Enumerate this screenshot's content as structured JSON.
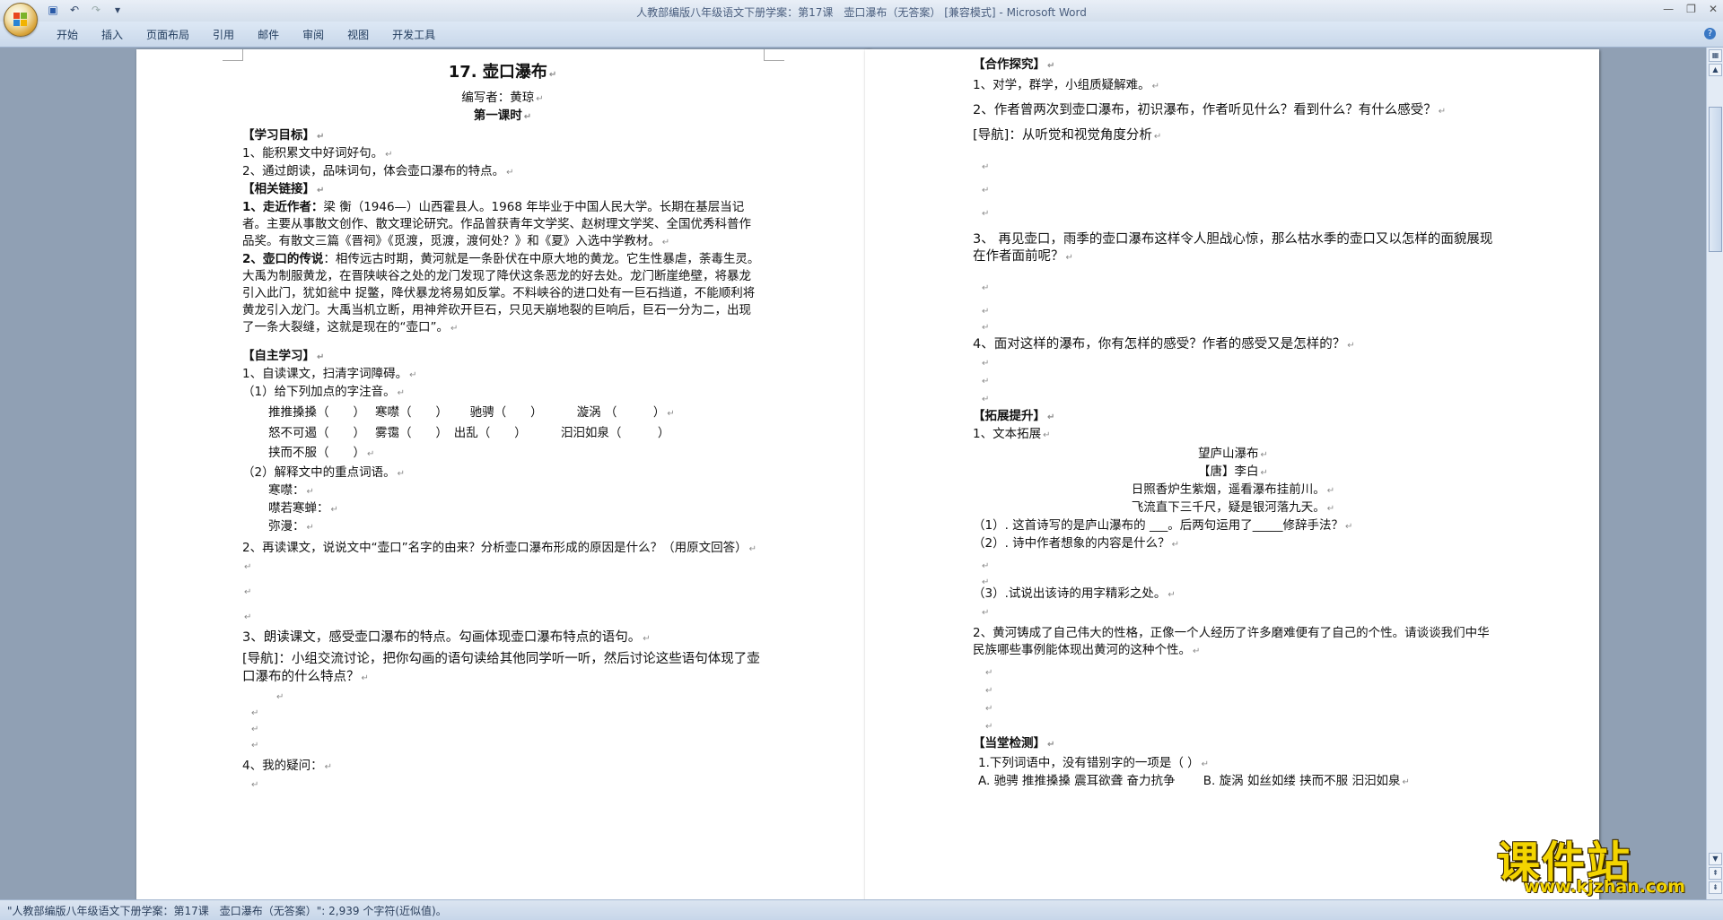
{
  "window": {
    "title": "人教部编版八年级语文下册学案：第17课　壶口瀑布（无答案） [兼容模式] - Microsoft Word"
  },
  "ribbon": {
    "tabs": [
      "开始",
      "插入",
      "页面布局",
      "引用",
      "邮件",
      "审阅",
      "视图",
      "开发工具"
    ]
  },
  "left_page": {
    "title": "17. 壶口瀑布",
    "author": "编写者：黄琼",
    "lesson": "第一课时",
    "goals_header": "【学习目标】",
    "goals": [
      "1、能积累文中好词好句。",
      "2、通过朗读，品味词句，体会壶口瀑布的特点。"
    ],
    "links_header": "【相关链接】",
    "link1_label": "1、走近作者：",
    "link1_text": "梁 衡（1946—）山西霍县人。1968 年毕业于中国人民大学。长期在基层当记者。主要从事散文创作、散文理论研究。作品曾获青年文学奖、赵树理文学奖、全国优秀科普作品奖。有散文三篇《晋祠》《觅渡，觅渡，渡何处？》和《夏》入选中学教材。",
    "link2_label": "2、壶口的传说",
    "link2_text": "：相传远古时期，黄河就是一条卧伏在中原大地的黄龙。它生性暴虐，荼毒生灵。大禹为制服黄龙，在晋陕峡谷之处的龙门发现了降伏这条恶龙的好去处。龙门断崖绝壁，将暴龙引入此门，犹如瓮中 捉鳖，降伏暴龙将易如反掌。不料峡谷的进口处有一巨石挡道，不能顺利将黄龙引入龙门。大禹当机立断，用神斧砍开巨石，只见天崩地裂的巨响后，巨石一分为二，出现了一条大裂缝，这就是现在的“壶口”。",
    "self_header": "【自主学习】",
    "self1": "1、自读课文，扫清字词障碍。",
    "self1a": "（1）给下列加点的字注音。",
    "pinyin_row1": "推推搡搡（　　）　 寒噤（　　）　　 驰骋（　　）　　　 漩涡 （　　　）",
    "pinyin_row2": "怒不可遏（　　）　 雾霭（　　）　出乱（　　）　　　 汩汩如泉（　　　）",
    "pinyin_row3": "挟而不服（　　）",
    "self1b": "（2）解释文中的重点词语。",
    "words": [
      "寒噤：",
      "噤若寒蝉：",
      "弥漫："
    ],
    "q2": "2、再读课文，说说文中“壶口”名字的由来？分析壶口瀑布形成的原因是什么？（用原文回答）",
    "q3": "3、朗读课文，感受壶口瀑布的特点。勾画体现壶口瀑布特点的语句。",
    "q3_nav": "[导航]：小组交流讨论，把你勾画的语句读给其他同学听一听，然后讨论这些语句体现了壶口瀑布的什么特点？",
    "q4": "4、我的疑问："
  },
  "right_page": {
    "coop_header": "【合作探究】",
    "c1": "1、对学，群学，小组质疑解难。",
    "c2": "2、作者曾两次到壶口瀑布，初识瀑布，作者听见什么？看到什么？有什么感受？",
    "c2_nav": "[导航]：从听觉和视觉角度分析",
    "c3": "3、 再见壶口，雨季的壶口瀑布这样令人胆战心惊，那么枯水季的壶口又以怎样的面貌展现在作者面前呢？",
    "c4": "4、面对这样的瀑布，你有怎样的感受？作者的感受又是怎样的？",
    "ext_header": "【拓展提升】",
    "e1": "1、文本拓展",
    "poem_title": "望庐山瀑布",
    "poem_author": "【唐】李白",
    "poem_l1": "日照香炉生紫烟，遥看瀑布挂前川。",
    "poem_l2": "飞流直下三千尺，疑是银河落九天。",
    "pq1": "（1）. 这首诗写的是庐山瀑布的 ___。后两句运用了_____修辞手法？",
    "pq2": "（2）. 诗中作者想象的内容是什么？",
    "pq3": "（3）.试说出该诗的用字精彩之处。",
    "e2": "2、黄河铸成了自己伟大的性格，正像一个人经历了许多磨难便有了自己的个性。请谈谈我们中华民族哪些事例能体现出黄河的这种个性。",
    "test_header": "【当堂检测】",
    "t1": "1.下列词语中，没有错别字的一项是（ ）",
    "t1_opts": "A. 驰骋 推推搡搡 震耳欲聋 奋力抗争　　 B. 旋涡 如丝如缕 挟而不服 汩汩如泉"
  },
  "status": {
    "text": "\"人教部编版八年级语文下册学案：第17课　壶口瀑布（无答案）\": 2,939 个字符(近似值)。"
  },
  "watermark": {
    "name": "课件站",
    "url": "www.kjzhan.com"
  }
}
